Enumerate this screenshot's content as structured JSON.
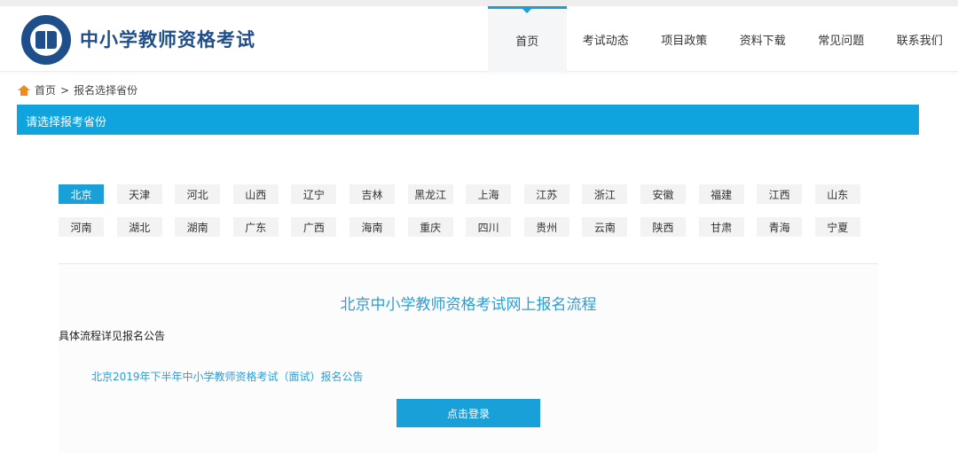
{
  "site": {
    "title": "中小学教师资格考试"
  },
  "nav": [
    {
      "label": "首页",
      "active": true
    },
    {
      "label": "考试动态"
    },
    {
      "label": "项目政策"
    },
    {
      "label": "资料下载"
    },
    {
      "label": "常见问题"
    },
    {
      "label": "联系我们"
    }
  ],
  "breadcrumb": {
    "home": "首页",
    "separator": ">",
    "current": "报名选择省份"
  },
  "section_title": "请选择报考省份",
  "provinces": [
    "北京",
    "天津",
    "河北",
    "山西",
    "辽宁",
    "吉林",
    "黑龙江",
    "上海",
    "江苏",
    "浙江",
    "安徽",
    "福建",
    "江西",
    "山东",
    "河南",
    "湖北",
    "湖南",
    "广东",
    "广西",
    "海南",
    "重庆",
    "四川",
    "贵州",
    "云南",
    "陕西",
    "甘肃",
    "青海",
    "宁夏"
  ],
  "selected_province": "北京",
  "content": {
    "flow_title": "北京中小学教师资格考试网上报名流程",
    "detail": "具体流程详见报名公告",
    "notice_link": "北京2019年下半年中小学教师资格考试（面试）报名公告",
    "login_button": "点击登录"
  },
  "colors": {
    "accent": "#1aa0d8",
    "brand": "#1f4f8a",
    "home_icon": "#f08a1c"
  }
}
